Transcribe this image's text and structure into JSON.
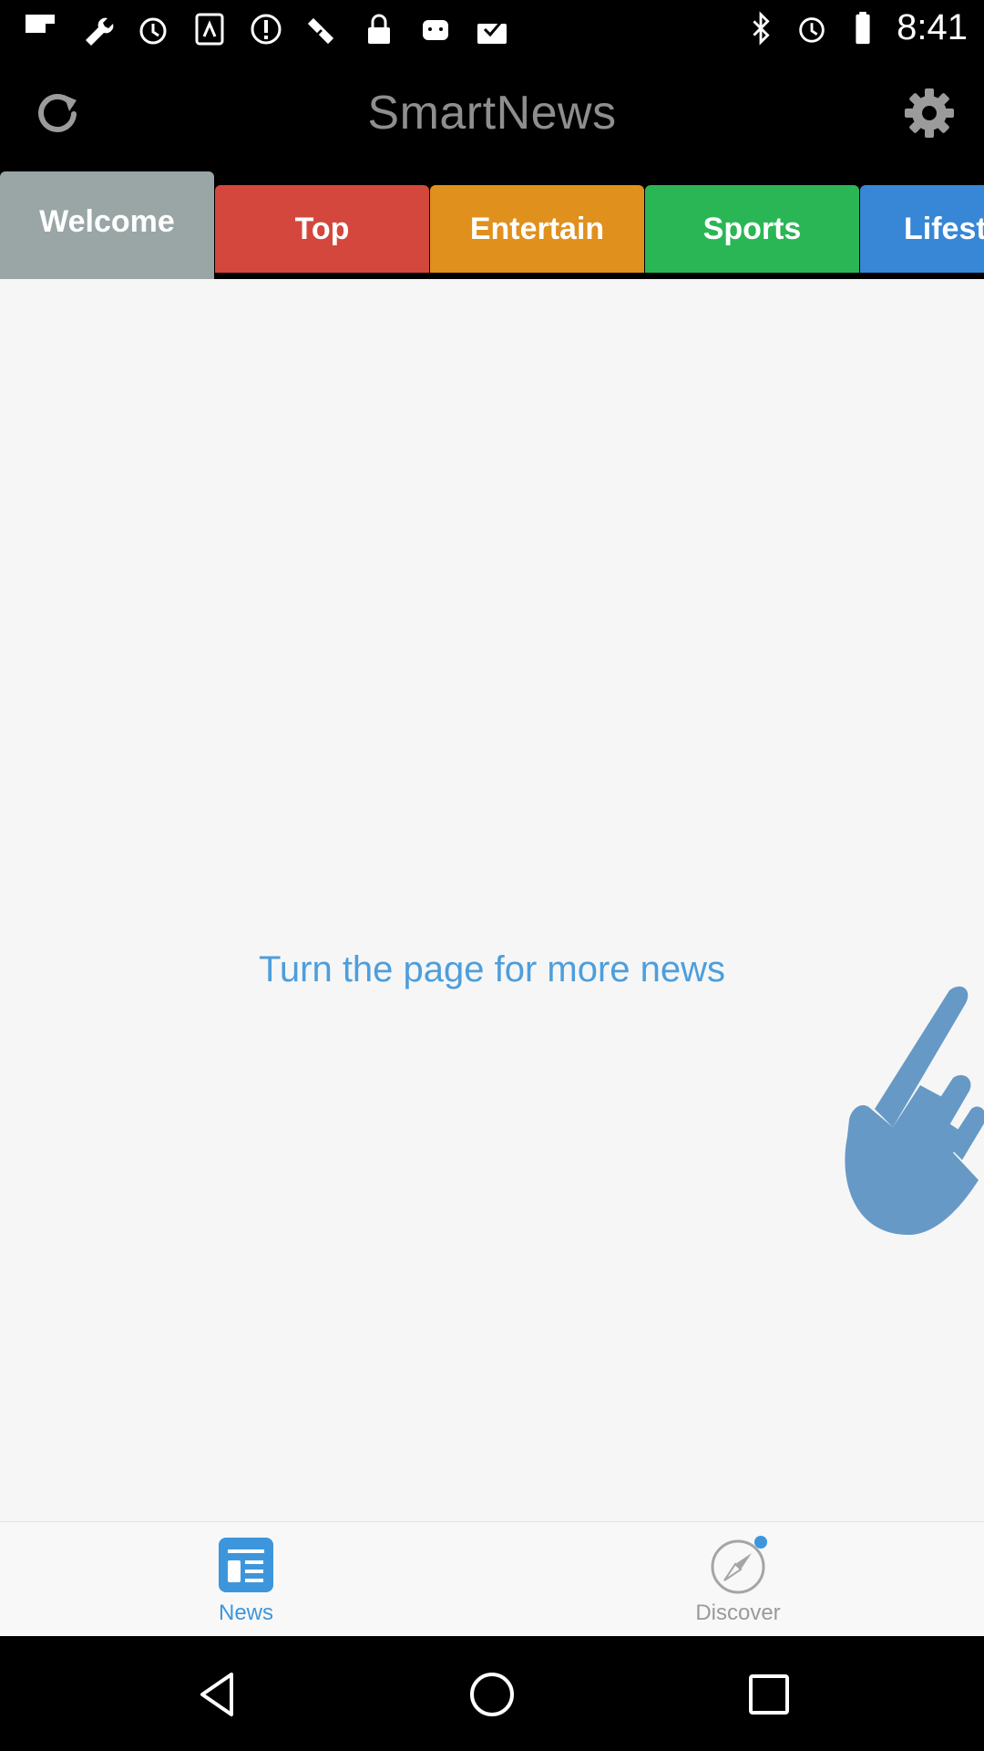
{
  "status_bar": {
    "time": "8:41",
    "left_icons": [
      "flipboard-icon",
      "wrench-icon",
      "alarm-icon",
      "app-icon",
      "info-icon",
      "satellite-icon",
      "lock-icon",
      "android-icon",
      "check-icon"
    ],
    "right_icons": [
      "bluetooth-icon",
      "alarm-icon",
      "battery-icon"
    ]
  },
  "app_bar": {
    "title": "SmartNews",
    "refresh_icon": "refresh-icon",
    "settings_icon": "gear-icon"
  },
  "tabs": [
    {
      "label": "Welcome",
      "color": "#9aa5a5",
      "active": true
    },
    {
      "label": "Top",
      "color": "#d4473c"
    },
    {
      "label": "Entertain",
      "color": "#e0901c"
    },
    {
      "label": "Sports",
      "color": "#2bb656"
    },
    {
      "label": "Lifest",
      "color": "#3787d6"
    }
  ],
  "main": {
    "hint_text": "Turn the page for more news",
    "hand_icon": "swipe-hand-icon",
    "hand_color": "#6699c6"
  },
  "bottom_nav": {
    "items": [
      {
        "label": "News",
        "icon": "news-icon",
        "active": true,
        "color": "#3d96dc"
      },
      {
        "label": "Discover",
        "icon": "compass-icon",
        "color": "#9a9a9a"
      }
    ]
  },
  "system_nav": {
    "icons": [
      "back-icon",
      "home-icon",
      "recents-icon"
    ]
  }
}
